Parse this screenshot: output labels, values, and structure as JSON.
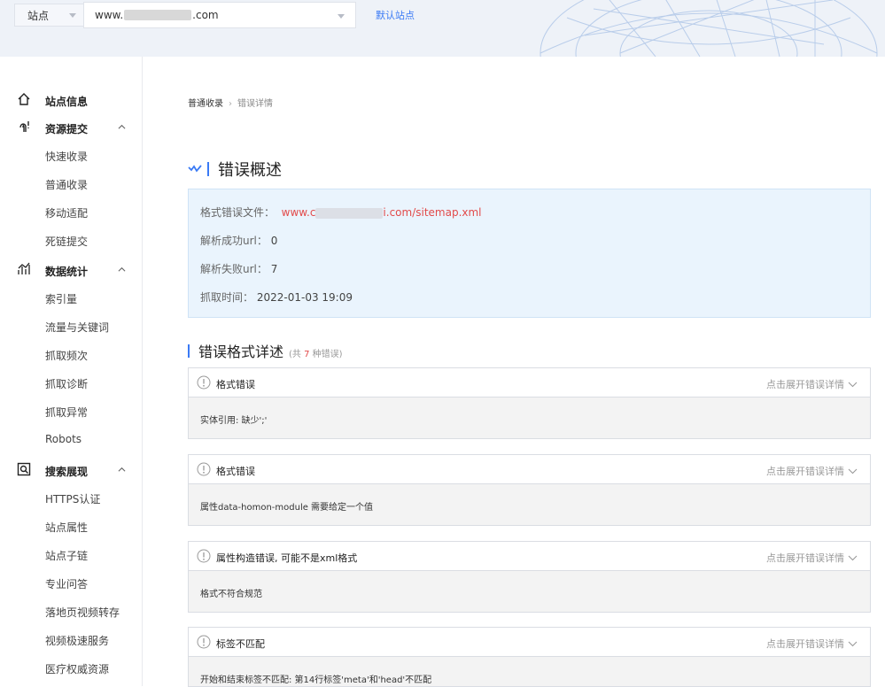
{
  "topbar": {
    "site_label": "站点",
    "site_prefix": "www.",
    "site_suffix": ".com",
    "default_site": "默认站点"
  },
  "sidebar": {
    "groups": [
      {
        "label": "站点信息",
        "icon": "home-icon",
        "items": []
      },
      {
        "label": "资源提交",
        "icon": "submit-icon",
        "items": [
          "快速收录",
          "普通收录",
          "移动适配",
          "死链提交"
        ]
      },
      {
        "label": "数据统计",
        "icon": "chart-icon",
        "items": [
          "索引量",
          "流量与关键词",
          "抓取频次",
          "抓取诊断",
          "抓取异常",
          "Robots"
        ]
      },
      {
        "label": "搜索展现",
        "icon": "search-display-icon",
        "items": [
          "HTTPS认证",
          "站点属性",
          "站点子链",
          "专业问答",
          "落地页视频转存",
          "视频极速服务",
          "医疗权威资源"
        ]
      }
    ]
  },
  "breadcrumb": {
    "parent": "普通收录",
    "current": "错误详情"
  },
  "overview": {
    "title": "错误概述",
    "file_label": "格式错误文件：",
    "file_prefix": "www.c",
    "file_suffix": "i.com/sitemap.xml",
    "success_label": "解析成功url：",
    "success_value": "0",
    "fail_label": "解析失败url：",
    "fail_value": "7",
    "time_label": "抓取时间：",
    "time_value": "2022-01-03 19:09"
  },
  "details": {
    "title": "错误格式详述",
    "count_prefix": "(共",
    "count_num": "7",
    "count_suffix": "种错误)",
    "toggle_label": "点击展开错误详情",
    "errors": [
      {
        "title": "格式错误",
        "message": "实体引用: 缺少';'"
      },
      {
        "title": "格式错误",
        "message": "属性data-homon-module 需要给定一个值"
      },
      {
        "title": "属性构造错误, 可能不是xml格式",
        "message": "格式不符合规范"
      },
      {
        "title": "标签不匹配",
        "message": "开始和结束标签不匹配: 第14行标签'meta'和'head'不匹配"
      }
    ]
  },
  "colors": {
    "accent": "#3a7af5",
    "error": "#e24a4a",
    "info_bg": "#eaf4fd"
  }
}
